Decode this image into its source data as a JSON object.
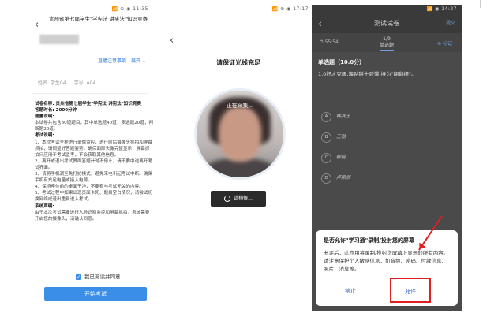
{
  "screen1": {
    "status": "📶 ⊕ ◉ 11:35",
    "title": "贵州省第七届学生\"学宪法 讲宪法\"知识竞赛",
    "links": [
      "直播注意事项",
      "展开 ⌄"
    ],
    "name": "姓名: 学生04",
    "id": "学号: A04",
    "body": [
      {
        "t": "试卷名称: 贵州省第七届学生\"学宪法 讲宪法\"知识竞赛",
        "h": true
      },
      {
        "t": "答题时长: 2000分钟",
        "h": true
      },
      {
        "t": "题量说明:",
        "h": true
      },
      {
        "t": "本试卷共包含80道题目，其中单选题40道，多选题20道，判断题20道。",
        "h": false
      },
      {
        "t": "考试说明:",
        "h": true
      },
      {
        "t": "1、本次考试全程进行录像监控，进行前后摄像头抓拍和屏幕抓拍，请调整好答题姿势，确保面部头像完整显示，屏幕抓拍只应用于考试监考，不会获取其他信息。",
        "h": false
      },
      {
        "t": "2、离开或退出考试界面答题计时不停止，请不要中途离开考试界面。",
        "h": false
      },
      {
        "t": "3、请将手机调至免打扰模式，避免来电引起考试中断。确保手机有充足电量或接入电源。",
        "h": false
      },
      {
        "t": "4、保持座位前的桌面干净，不要有与考试无关的内容。",
        "h": false
      },
      {
        "t": "5、考试过程中如果出现页面卡死、题目空白情况，请尝试切换网络或退出重新进入考试。",
        "h": false
      },
      {
        "t": "系统声明:",
        "h": true
      },
      {
        "t": "由于本次考试需要进行人脸识别监控和屏幕抓拍，系统需要开启您的摄像头，请确认同意。",
        "h": false
      }
    ],
    "agree": "我已阅读并同意",
    "start": "开始考试"
  },
  "screen2": {
    "status": "📶 ⊕ ◉ 17:17",
    "title": "请保证光线充足",
    "collecting": "正在采集...",
    "loading": "请稍候..."
  },
  "screen3": {
    "status": "📶 ◉ 14:27",
    "header": "测试试卷",
    "header_right": "提交",
    "timer": "⏱ 55:54",
    "count": "1/9",
    "count_sub": "单选题",
    "mid": "⊖ 标记",
    "section": "单选题（10.0分）",
    "question": "1.0好才克服,海贴掰士骄饿,持为\"翻翻檐\"。",
    "options": [
      {
        "k": "A",
        "v": "韩其王"
      },
      {
        "k": "B",
        "v": "王勃"
      },
      {
        "k": "C",
        "v": "柳柯"
      },
      {
        "k": "D",
        "v": "卢照邻"
      }
    ],
    "dialog": {
      "title": "是否允许\"学习通\"录制/投射您的屏幕",
      "body": "允许后，此应用将录制/投射您屏幕上显示的所有内容。请注意保护个人敏感信息，如音频、密码、付款信息、照片、消息等。",
      "deny": "禁止",
      "allow": "允许"
    }
  }
}
